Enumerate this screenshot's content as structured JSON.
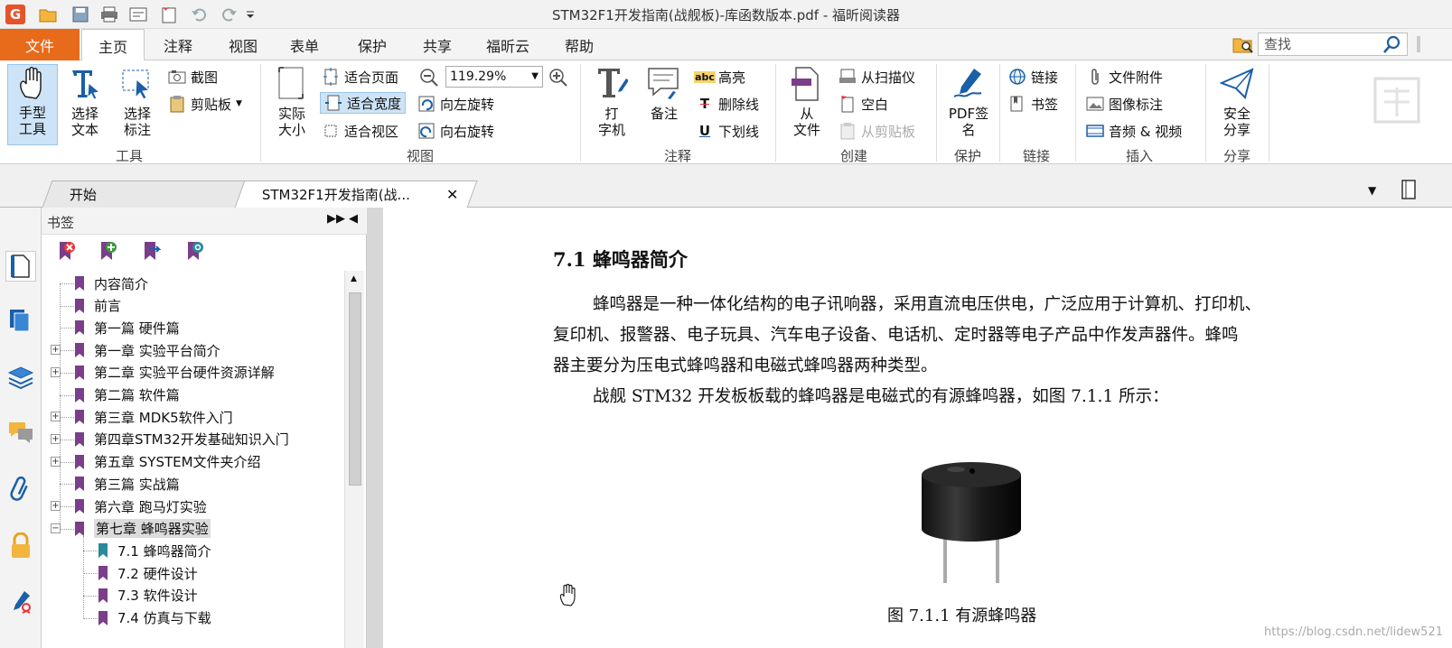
{
  "window": {
    "title": "STM32F1开发指南(战舰板)-库函数版本.pdf - 福昕阅读器",
    "app_logo": "G"
  },
  "menu": {
    "file": "文件",
    "tabs": [
      "主页",
      "注释",
      "视图",
      "表单",
      "保护",
      "共享",
      "福昕云",
      "帮助"
    ],
    "search_placeholder": "查找"
  },
  "ribbon": {
    "tools": {
      "hand": "手型\n工具",
      "select_text": "选择\n文本",
      "select_annot": "选择\n标注",
      "screenshot": "截图",
      "clipboard": "剪贴板",
      "label": "工具"
    },
    "view": {
      "actual_size": "实际\n大小",
      "fit_page": "适合页面",
      "fit_width": "适合宽度",
      "fit_view": "适合视区",
      "zoom": "119.29%",
      "rotate_left": "向左旋转",
      "rotate_right": "向右旋转",
      "label": "视图"
    },
    "comment": {
      "typewriter": "打\n字机",
      "note": "备注",
      "highlight": "高亮",
      "strikeout": "删除线",
      "underline": "下划线",
      "label": "注释",
      "abc": "abc",
      "t_sym": "T",
      "u_sym": "U"
    },
    "create": {
      "from_file": "从\n文件",
      "from_scanner": "从扫描仪",
      "blank": "空白",
      "from_clipboard": "从剪贴板",
      "label": "创建"
    },
    "protect": {
      "pdf_sign": "PDF签\n名",
      "label": "保护"
    },
    "links": {
      "link": "链接",
      "bookmark": "书签",
      "label": "链接"
    },
    "insert": {
      "attachment": "文件附件",
      "image_annot": "图像标注",
      "audio_video": "音频 & 视频",
      "label": "插入"
    },
    "share": {
      "secure_share": "安全\n分享",
      "label": "分享"
    }
  },
  "doc_tabs": [
    "开始",
    "STM32F1开发指南(战..."
  ],
  "bookmarks": {
    "title": "书签",
    "items": [
      {
        "label": "内容简介",
        "level": 0,
        "expandable": false
      },
      {
        "label": "前言",
        "level": 0,
        "expandable": false
      },
      {
        "label": "第一篇 硬件篇",
        "level": 0,
        "expandable": false
      },
      {
        "label": "第一章 实验平台简介",
        "level": 0,
        "expandable": true
      },
      {
        "label": "第二章 实验平台硬件资源详解",
        "level": 0,
        "expandable": true
      },
      {
        "label": "第二篇 软件篇",
        "level": 0,
        "expandable": false
      },
      {
        "label": "第三章 MDK5软件入门",
        "level": 0,
        "expandable": true
      },
      {
        "label": "第四章STM32开发基础知识入门",
        "level": 0,
        "expandable": true
      },
      {
        "label": "第五章 SYSTEM文件夹介绍",
        "level": 0,
        "expandable": true
      },
      {
        "label": "第三篇 实战篇",
        "level": 0,
        "expandable": false
      },
      {
        "label": "第六章 跑马灯实验",
        "level": 0,
        "expandable": true
      },
      {
        "label": "第七章 蜂鸣器实验",
        "level": 0,
        "expandable": true,
        "expanded": true,
        "selected": true
      },
      {
        "label": "7.1 蜂鸣器简介",
        "level": 1,
        "expandable": false,
        "current": true
      },
      {
        "label": "7.2 硬件设计",
        "level": 1,
        "expandable": false
      },
      {
        "label": "7.3 软件设计",
        "level": 1,
        "expandable": false
      },
      {
        "label": "7.4 仿真与下载",
        "level": 1,
        "expandable": false
      }
    ]
  },
  "document": {
    "heading": "7.1  蜂鸣器简介",
    "para1_line1": "蜂鸣器是一种一体化结构的电子讯响器，采用直流电压供电，广泛应用于计算机、打印机、",
    "para1_line2": "复印机、报警器、电子玩具、汽车电子设备、电话机、定时器等电子产品中作发声器件。蜂鸣",
    "para1_line3": "器主要分为压电式蜂鸣器和电磁式蜂鸣器两种类型。",
    "para2": "战舰 STM32 开发板板载的蜂鸣器是电磁式的有源蜂鸣器，如图 7.1.1 所示：",
    "caption": "图 7.1.1  有源蜂鸣器",
    "watermark": "https://blog.csdn.net/lidew521"
  },
  "colors": {
    "accent_orange": "#e86a1b",
    "bookmark_purple": "#7a3e8a",
    "bookmark_teal": "#2a8a9a",
    "active_blue": "#cde3f7"
  }
}
